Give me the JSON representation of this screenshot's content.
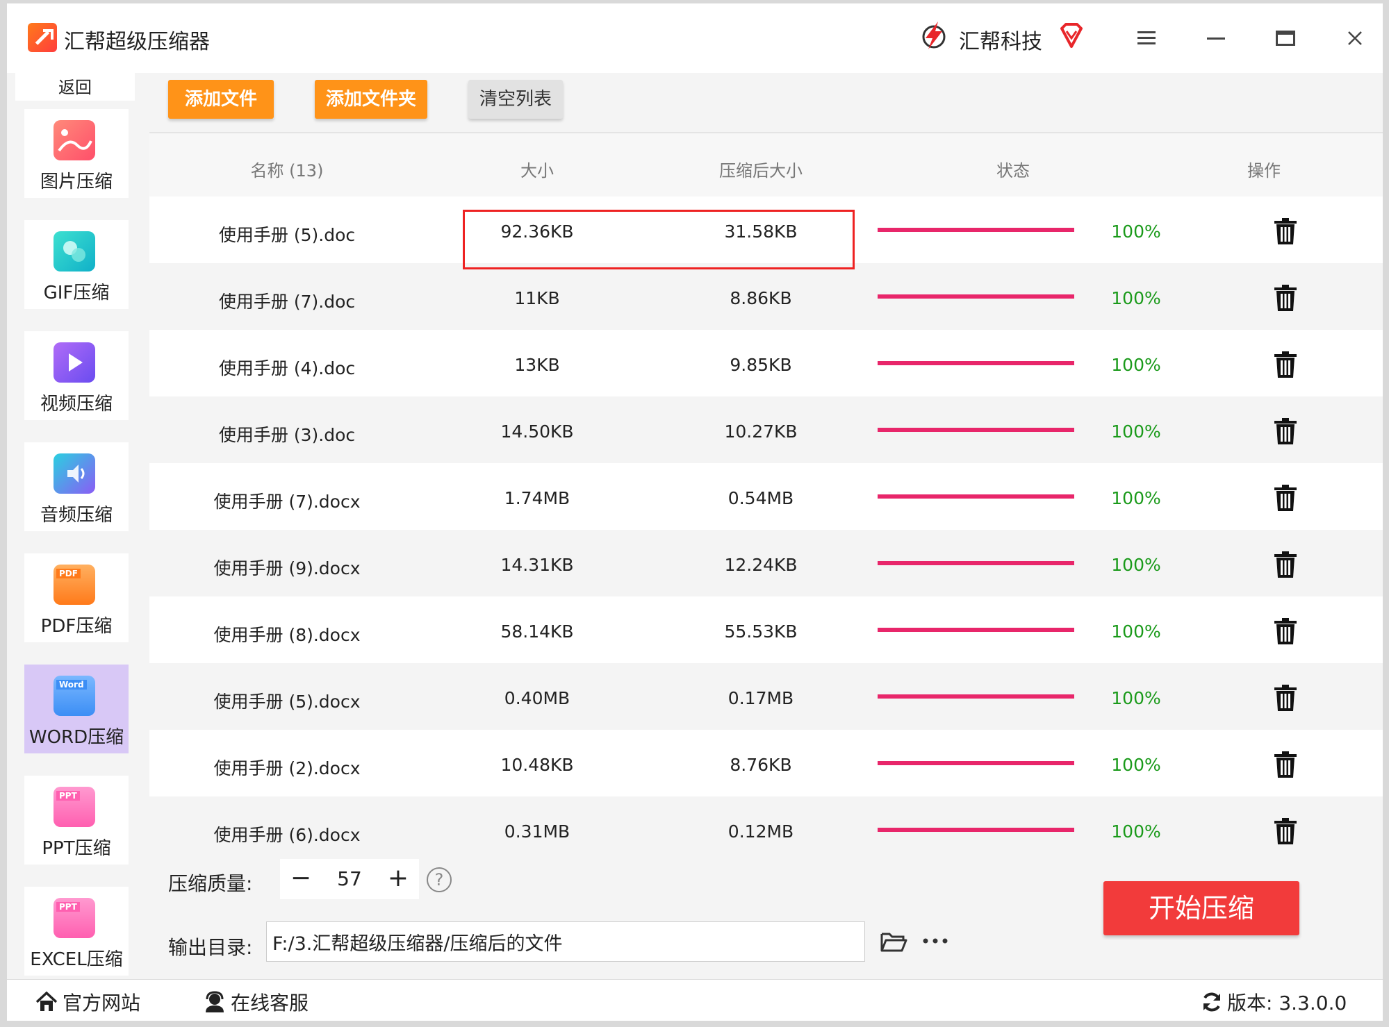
{
  "titlebar": {
    "app_title": "汇帮超级压缩器",
    "brand_name": "汇帮科技"
  },
  "sidebar": {
    "back_label": "返回",
    "items": [
      {
        "label": "图片压缩",
        "icon": "image-icon",
        "color": "#ff5a6e"
      },
      {
        "label": "GIF压缩",
        "icon": "gif-icon",
        "color": "#1cc9c0"
      },
      {
        "label": "视频压缩",
        "icon": "video-icon",
        "color": "#8a5cf5"
      },
      {
        "label": "音频压缩",
        "icon": "audio-icon",
        "color": "#6c7cf7"
      },
      {
        "label": "PDF压缩",
        "icon": "pdf-icon",
        "color": "#ff8a2a"
      },
      {
        "label": "WORD压缩",
        "icon": "word-icon",
        "color": "#3c8ef5",
        "active": true
      },
      {
        "label": "PPT压缩",
        "icon": "ppt-icon",
        "color": "#ff5fb0"
      },
      {
        "label": "EXCEL压缩",
        "icon": "excel-icon",
        "color": "#ff5fb0"
      }
    ]
  },
  "toolbar": {
    "add_file": "添加文件",
    "add_folder": "添加文件夹",
    "clear_list": "清空列表"
  },
  "table": {
    "headers": {
      "name": "名称 (13)",
      "size": "大小",
      "compressed": "压缩后大小",
      "status": "状态",
      "action": "操作"
    },
    "rows": [
      {
        "name": "使用手册 (5).doc",
        "size": "92.36KB",
        "compressed": "31.58KB",
        "progress": 100,
        "percent": "100%"
      },
      {
        "name": "使用手册 (7).doc",
        "size": "11KB",
        "compressed": "8.86KB",
        "progress": 100,
        "percent": "100%"
      },
      {
        "name": "使用手册 (4).doc",
        "size": "13KB",
        "compressed": "9.85KB",
        "progress": 100,
        "percent": "100%"
      },
      {
        "name": "使用手册 (3).doc",
        "size": "14.50KB",
        "compressed": "10.27KB",
        "progress": 100,
        "percent": "100%"
      },
      {
        "name": "使用手册 (7).docx",
        "size": "1.74MB",
        "compressed": "0.54MB",
        "progress": 100,
        "percent": "100%"
      },
      {
        "name": "使用手册 (9).docx",
        "size": "14.31KB",
        "compressed": "12.24KB",
        "progress": 100,
        "percent": "100%"
      },
      {
        "name": "使用手册 (8).docx",
        "size": "58.14KB",
        "compressed": "55.53KB",
        "progress": 100,
        "percent": "100%"
      },
      {
        "name": "使用手册 (5).docx",
        "size": "0.40MB",
        "compressed": "0.17MB",
        "progress": 100,
        "percent": "100%"
      },
      {
        "name": "使用手册 (2).docx",
        "size": "10.48KB",
        "compressed": "8.76KB",
        "progress": 100,
        "percent": "100%"
      },
      {
        "name": "使用手册 (6).docx",
        "size": "0.31MB",
        "compressed": "0.12MB",
        "progress": 100,
        "percent": "100%"
      }
    ]
  },
  "controls": {
    "quality_label": "压缩质量:",
    "quality_value": "57",
    "minus": "−",
    "plus": "+",
    "help": "?",
    "output_label": "输出目录:",
    "output_path": "F:/3.汇帮超级压缩器/压缩后的文件",
    "start_button": "开始压缩"
  },
  "footer": {
    "website": "官方网站",
    "support": "在线客服",
    "version": "版本: 3.3.0.0"
  },
  "colors": {
    "accent_orange": "#ff9318",
    "start_red": "#f23b3b",
    "progress_pink": "#e8266a",
    "percent_green": "#1a9a1a",
    "highlight_red": "#ee2222"
  }
}
